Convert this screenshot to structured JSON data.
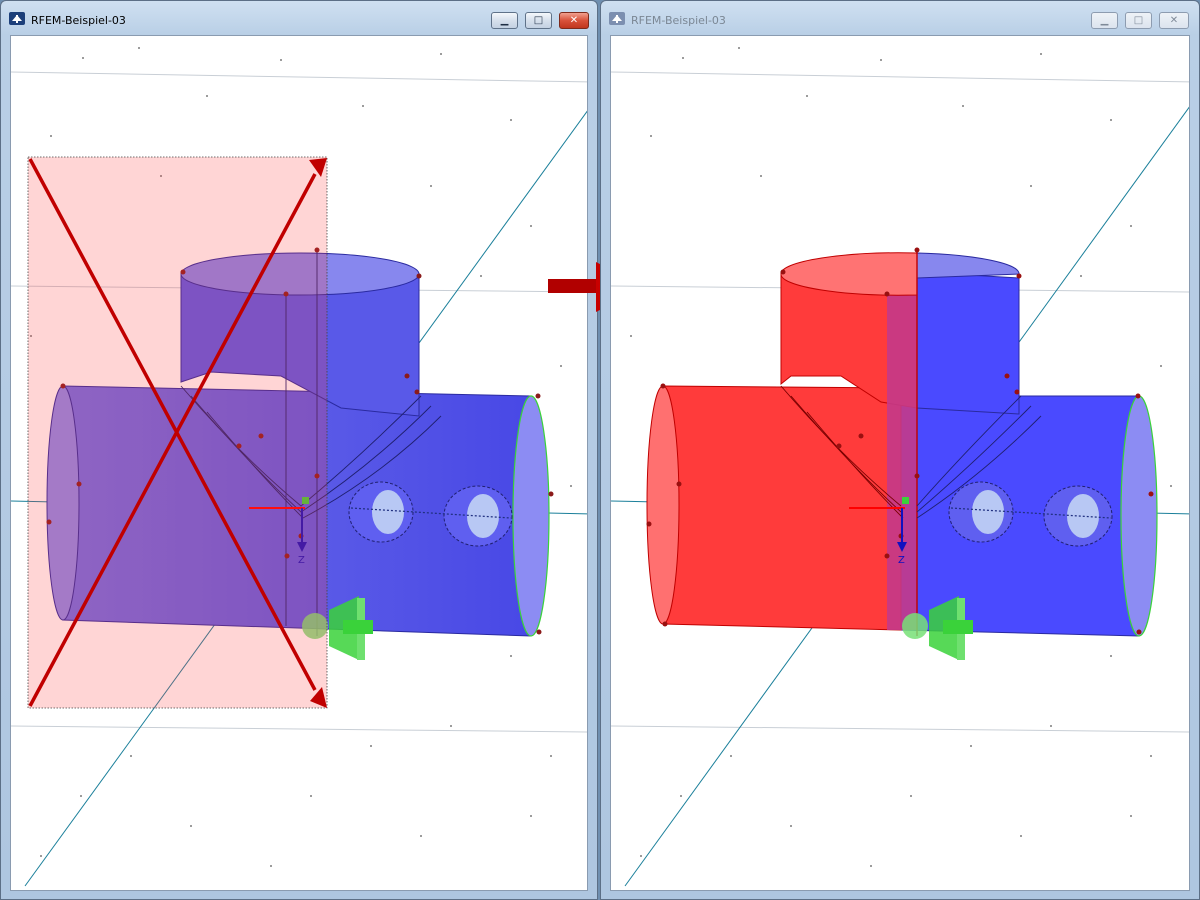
{
  "left_window": {
    "title": "RFEM-Beispiel-03",
    "buttons": {
      "minimize": "▁",
      "maximize": "□",
      "close": "✕"
    },
    "axis_label": "Z"
  },
  "right_window": {
    "title": "RFEM-Beispiel-03",
    "buttons": {
      "minimize": "▁",
      "maximize": "□",
      "close": "✕"
    },
    "axis_label": "Z"
  },
  "icons": {
    "app": "rfem-app-icon",
    "crossed_selection": "red-x-cancel-icon",
    "transition": "right-arrow-icon",
    "support": "green-support-icon"
  },
  "colors": {
    "selection_red": "#ff2a2a",
    "member_blue": "#4a4aff",
    "annotation_red": "#c00000",
    "axis_cyan": "#1a7f9a",
    "support_green": "#3ad23a"
  }
}
